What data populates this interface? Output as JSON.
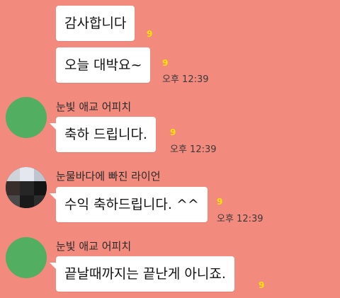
{
  "messages": [
    {
      "text": "감사합니다",
      "unread": "9"
    },
    {
      "text": "오늘 대박요~",
      "unread": "9",
      "time": "오후 12:39"
    },
    {
      "sender": "눈빛 애교 어피치",
      "text": "축하 드립니다.",
      "unread": "9",
      "time": "오후 12:39"
    },
    {
      "sender": "눈물바다에 빠진 라이언",
      "text": "수익 축하드립니다. ^^",
      "unread": "9",
      "time": "오후 12:39"
    },
    {
      "sender": "눈빛 애교 어피치",
      "text": "끝날때까지는 끝난게 아니죠.",
      "unread": "9"
    }
  ],
  "colors": {
    "background": "#F28A7E",
    "bubble": "#FFFFFF",
    "unread": "#FFE400",
    "avatar_green": "#52AE61"
  }
}
